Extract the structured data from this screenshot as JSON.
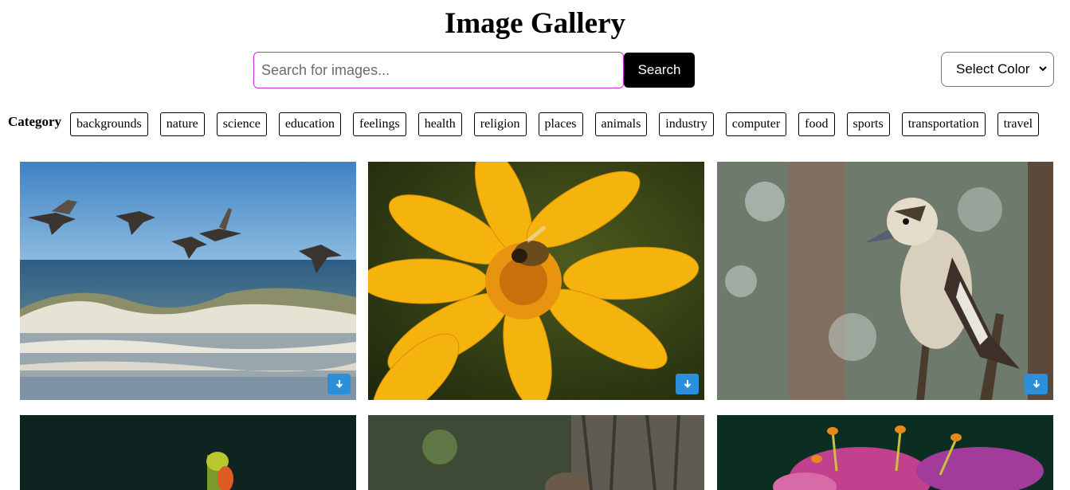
{
  "header": {
    "title": "Image Gallery"
  },
  "search": {
    "placeholder": "Search for images...",
    "button_label": "Search"
  },
  "color_select": {
    "selected": "Select Color"
  },
  "category": {
    "label": "Category",
    "items": [
      "backgrounds",
      "nature",
      "science",
      "education",
      "feelings",
      "health",
      "religion",
      "places",
      "animals",
      "industry",
      "computer",
      "food",
      "sports",
      "transportation",
      "travel"
    ]
  },
  "gallery": {
    "images": [
      {
        "subject": "pelicans flying over ocean waves",
        "download_icon": "download-arrow-icon"
      },
      {
        "subject": "bee on yellow flower",
        "download_icon": "download-arrow-icon"
      },
      {
        "subject": "kookaburra perched on branch",
        "download_icon": "download-arrow-icon"
      },
      {
        "subject": "flower bud on dark green background"
      },
      {
        "subject": "squirrel beside tree trunk"
      },
      {
        "subject": "pink lily flower"
      }
    ]
  },
  "colors": {
    "search_border": "#d22bd8",
    "search_button_bg": "#000000",
    "download_button_bg": "#2b8fd9"
  }
}
